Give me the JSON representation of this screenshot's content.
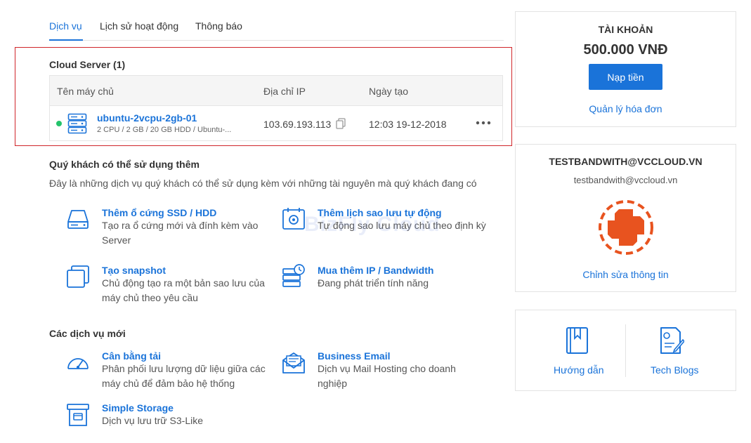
{
  "tabs": [
    {
      "label": "Dịch vụ"
    },
    {
      "label": "Lịch sử hoạt động"
    },
    {
      "label": "Thông báo"
    }
  ],
  "cloud_server": {
    "title": "Cloud Server (1)",
    "columns": [
      "Tên máy chủ",
      "Địa chỉ IP",
      "Ngày tạo"
    ],
    "rows": [
      {
        "status": "running",
        "name": "ubuntu-2vcpu-2gb-01",
        "spec": "2 CPU / 2 GB / 20 GB HDD / Ubuntu-...",
        "ip": "103.69.193.113",
        "created": "12:03 19-12-2018"
      }
    ]
  },
  "extras": {
    "title": "Quý khách có thể sử dụng thêm",
    "subtitle": "Đây là những dịch vụ quý khách có thể sử dụng kèm với những tài nguyên mà quý khách đang có",
    "items": [
      {
        "icon": "hard-drive-icon",
        "title": "Thêm ổ cứng SSD / HDD",
        "desc": "Tạo ra ổ cứng mới và đính kèm vào Server"
      },
      {
        "icon": "backup-schedule-icon",
        "title": "Thêm lịch sao lưu tự động",
        "desc": "Tự động sao lưu máy chủ theo định kỳ"
      },
      {
        "icon": "snapshot-icon",
        "title": "Tạo snapshot",
        "desc": "Chủ động tạo ra một bản sao lưu của máy chủ theo yêu cầu"
      },
      {
        "icon": "ip-bandwidth-icon",
        "title": "Mua thêm IP / Bandwidth",
        "desc": "Đang phát triển tính năng"
      }
    ]
  },
  "new_services": {
    "title": "Các dịch vụ mới",
    "items": [
      {
        "icon": "load-balancer-icon",
        "title": "Cân bằng tải",
        "desc": "Phân phối lưu lượng dữ liệu giữa các máy chủ để đảm bảo hệ thống"
      },
      {
        "icon": "business-email-icon",
        "title": "Business Email",
        "desc": "Dịch vụ Mail Hosting cho doanh nghiệp"
      },
      {
        "icon": "storage-icon",
        "title": "Simple Storage",
        "desc": "Dịch vụ lưu trữ S3-Like"
      }
    ]
  },
  "account": {
    "label": "TÀI KHOẢN",
    "balance": "500.000 VNĐ",
    "topup_label": "Nạp tiền",
    "invoice_link": "Quản lý hóa đơn"
  },
  "profile": {
    "email_upper": "TESTBANDWITH@VCCLOUD.VN",
    "email": "testbandwith@vccloud.vn",
    "edit_link": "Chỉnh sửa thông tin"
  },
  "help": {
    "guide_label": "Hướng dẫn",
    "blog_label": "Tech Blogs"
  },
  "watermark": "BizFly Cloud",
  "colors": {
    "accent": "#1a73d9",
    "status_running": "#24c36b",
    "highlight_border": "#d0262a",
    "avatar": "#e8531f"
  }
}
